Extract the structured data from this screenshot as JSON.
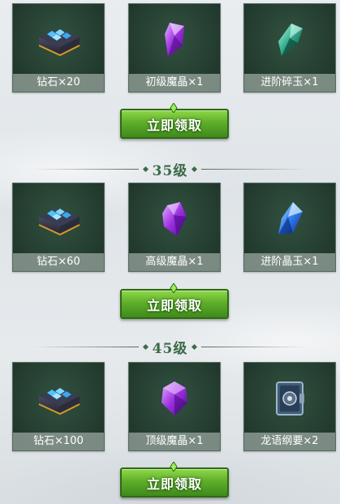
{
  "tiers": [
    {
      "level": "",
      "button_label": "立即领取",
      "rewards": [
        {
          "label": "钻石×20",
          "icon": "diamond-chest-icon"
        },
        {
          "label": "初级魔晶×1",
          "icon": "purple-crystal-icon"
        },
        {
          "label": "进阶碎玉×1",
          "icon": "jade-shard-icon"
        }
      ]
    },
    {
      "level": "35级",
      "button_label": "立即领取",
      "rewards": [
        {
          "label": "钻石×60",
          "icon": "diamond-chest-icon"
        },
        {
          "label": "高级魔晶×1",
          "icon": "purple-crystal-icon"
        },
        {
          "label": "进阶晶玉×1",
          "icon": "blue-crystal-icon"
        }
      ]
    },
    {
      "level": "45级",
      "button_label": "立即领取",
      "rewards": [
        {
          "label": "钻石×100",
          "icon": "diamond-chest-icon"
        },
        {
          "label": "顶级魔晶×1",
          "icon": "purple-gem-icon"
        },
        {
          "label": "龙语纲要×2",
          "icon": "rune-book-icon"
        }
      ]
    }
  ],
  "colors": {
    "card_bg": "#223a2e",
    "button_green": "#5fae2a",
    "level_text": "#3c6a47"
  }
}
